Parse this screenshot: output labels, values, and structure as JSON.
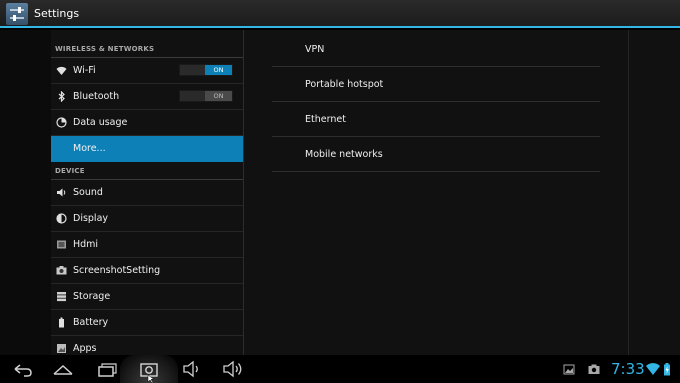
{
  "actionbar": {
    "title": "Settings"
  },
  "sections": [
    {
      "header": "WIRELESS & NETWORKS",
      "items": [
        {
          "label": "Wi-Fi",
          "icon": "wifi-icon",
          "toggle": "ON",
          "toggle_state": "on"
        },
        {
          "label": "Bluetooth",
          "icon": "bluetooth-icon",
          "toggle": "ON",
          "toggle_state": "off"
        },
        {
          "label": "Data usage",
          "icon": "data-usage-icon"
        },
        {
          "label": "More...",
          "icon": "",
          "selected": true
        }
      ]
    },
    {
      "header": "DEVICE",
      "items": [
        {
          "label": "Sound",
          "icon": "speaker-icon"
        },
        {
          "label": "Display",
          "icon": "brightness-icon"
        },
        {
          "label": "Hdmi",
          "icon": "hdmi-icon"
        },
        {
          "label": "ScreenshotSetting",
          "icon": "camera-icon"
        },
        {
          "label": "Storage",
          "icon": "storage-icon"
        },
        {
          "label": "Battery",
          "icon": "battery-icon"
        },
        {
          "label": "Apps",
          "icon": "apps-icon"
        }
      ]
    }
  ],
  "detail": {
    "items": [
      "VPN",
      "Portable hotspot",
      "Ethernet",
      "Mobile networks"
    ]
  },
  "navbar": {
    "buttons": [
      "back-icon",
      "home-icon",
      "recent-apps-icon",
      "screenshot-icon",
      "volume-down-icon",
      "volume-up-icon"
    ],
    "status": {
      "time": "7:33"
    }
  },
  "colors": {
    "accent": "#33b5e5",
    "selected": "#0d80b8"
  }
}
